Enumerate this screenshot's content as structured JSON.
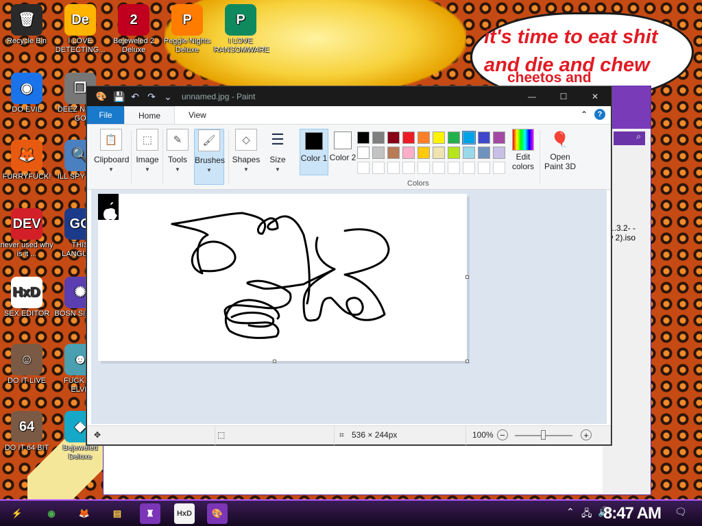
{
  "desktop": {
    "icons": [
      {
        "label": "Recycle Bin",
        "color": "#2a2a2a",
        "glyph": "🗑"
      },
      {
        "label": "I LOVE DETECTING...",
        "color": "#ffb400",
        "glyph": "De"
      },
      {
        "label": "Bejeweled 2 Deluxe",
        "color": "#c0001e",
        "glyph": "2"
      },
      {
        "label": "Peggle Nights Deluxe",
        "color": "#ff7c00",
        "glyph": "P"
      },
      {
        "label": "I LOVE RANSOMWARE",
        "color": "#0f8a5f",
        "glyph": "P"
      },
      {
        "label": "DO EVIL",
        "color": "#1a73e8",
        "glyph": "◉"
      },
      {
        "label": "DEEZ N HAH GO",
        "color": "#777777",
        "glyph": "❐"
      },
      {
        "label": "FURRYFUCK!",
        "color": "#e85a10",
        "glyph": "🦊"
      },
      {
        "label": "ILL SPY YOU",
        "color": "#4a7fc0",
        "glyph": "🔍"
      },
      {
        "label": "never used why is it ...",
        "color": "#d32028",
        "glyph": "DEV"
      },
      {
        "label": "THIS LANGUAG",
        "color": "#1b3a8a",
        "glyph": "GO"
      },
      {
        "label": "SEX EDITOR",
        "color": "#ffffff",
        "glyph": "HxD"
      },
      {
        "label": "BOSN SIMULA",
        "color": "#5b3fb0",
        "glyph": "✺"
      },
      {
        "label": "DO IT LIVE",
        "color": "#7a5a44",
        "glyph": "☺"
      },
      {
        "label": "FUCK SC ELVE",
        "color": "#4a9fb0",
        "glyph": "☻"
      },
      {
        "label": "DO IT 64 BIT",
        "color": "#7a5a44",
        "glyph": "64"
      },
      {
        "label": "Bejeweled Deluxe",
        "color": "#16a8c8",
        "glyph": "◆"
      }
    ],
    "bubble_text": "it's time to eat shit and die and chew",
    "bubble_text2": "cheetos and",
    "iso_text": "...3.2- -pow 2).iso"
  },
  "paint": {
    "title": "unnamed.jpg - Paint",
    "app_icon": "paint-icon",
    "quick_access": [
      "save-icon",
      "undo-icon",
      "redo-icon",
      "customize-icon"
    ],
    "window_buttons": {
      "minimize": "—",
      "maximize": "☐",
      "close": "✕"
    },
    "tabs": {
      "file": "File",
      "home": "Home",
      "view": "View"
    },
    "help": "?",
    "ribbon": {
      "clipboard": "Clipboard",
      "image": "Image",
      "tools": "Tools",
      "brushes": "Brushes",
      "shapes": "Shapes",
      "size": "Size",
      "color1": "Color 1",
      "color2": "Color 2",
      "colors_group": "Colors",
      "edit_colors": "Edit colors",
      "open_paint3d": "Open Paint 3D"
    },
    "palette_row1": [
      "#000000",
      "#7f7f7f",
      "#880015",
      "#ed1c24",
      "#ff7f27",
      "#fff200",
      "#22b14c",
      "#00a2e8",
      "#3f48cc",
      "#a349a4"
    ],
    "palette_row2": [
      "#ffffff",
      "#c3c3c3",
      "#b97a57",
      "#ffaec9",
      "#ffc90e",
      "#efe4b0",
      "#b5e61d",
      "#99d9ea",
      "#7092be",
      "#c8bfe7"
    ],
    "color1_value": "#000000",
    "color2_value": "#ffffff",
    "status": {
      "dimensions": "536 × 244px",
      "zoom": "100%"
    }
  },
  "taskbar": {
    "clock": "8:47 AM",
    "items": [
      "start-icon",
      "chrome-icon",
      "firefox-icon",
      "file-explorer-icon",
      "app-icon",
      "hxd-icon",
      "paint-icon"
    ]
  }
}
